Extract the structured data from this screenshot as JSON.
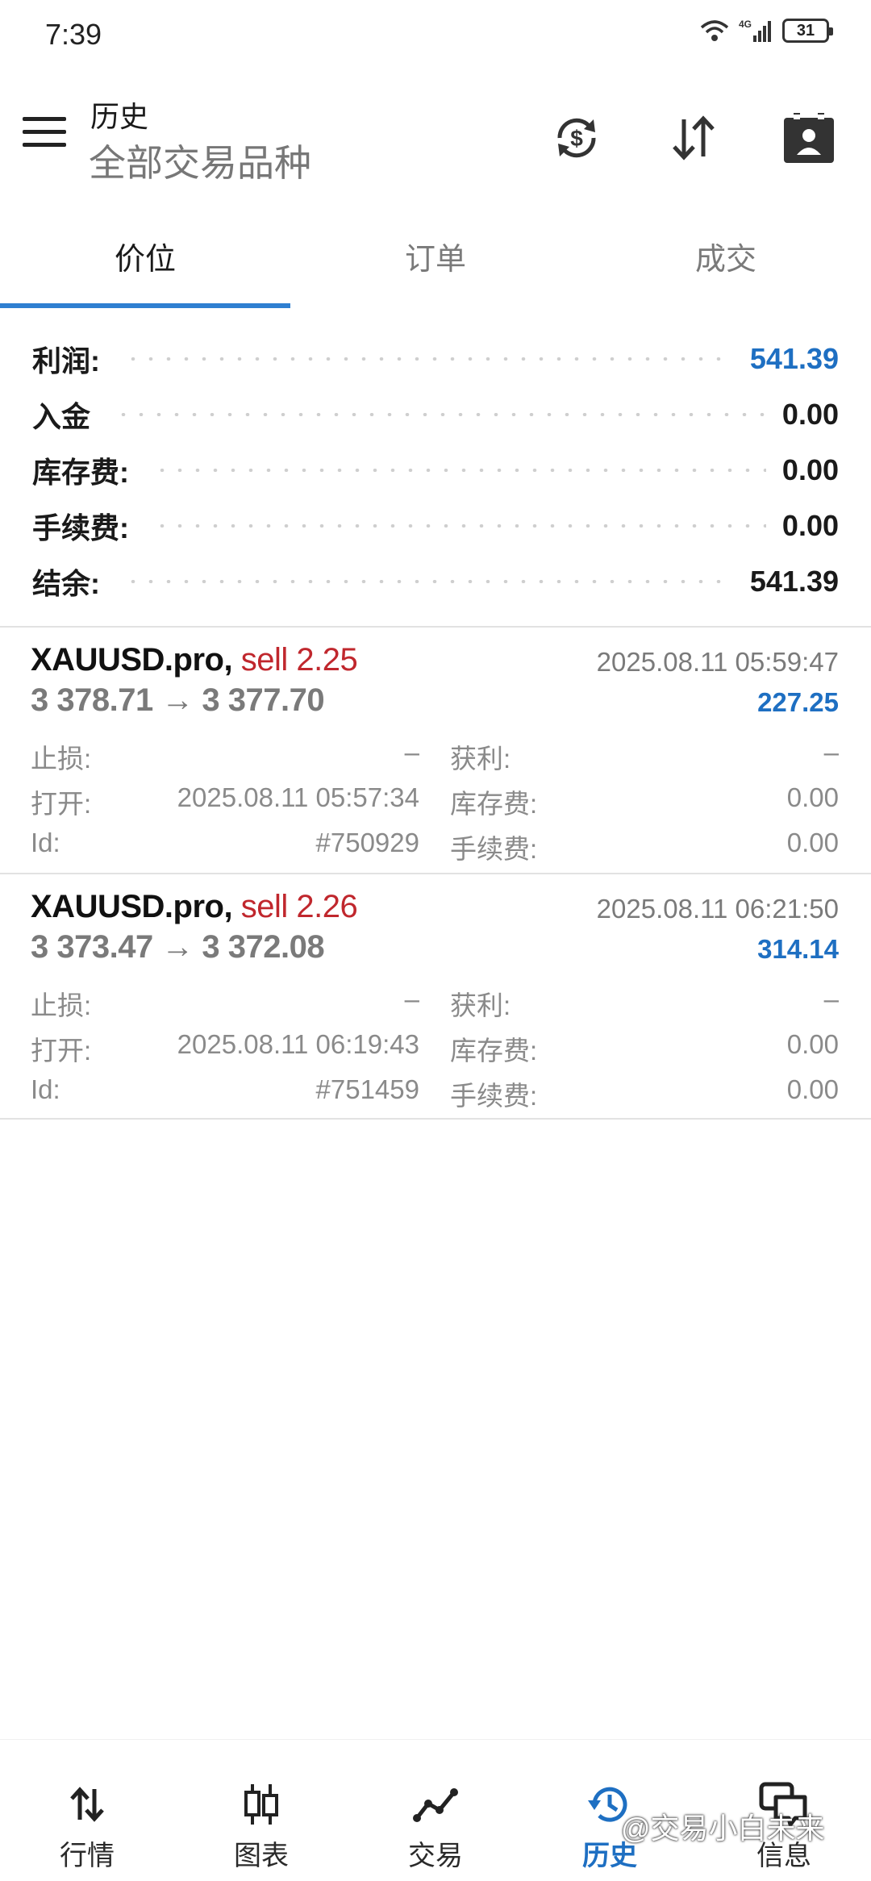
{
  "status_bar": {
    "time": "7:39",
    "network": "4G",
    "wifi_label": "6",
    "battery": "31"
  },
  "header": {
    "title": "历史",
    "subtitle": "全部交易品种",
    "icons": [
      "currency-exchange-icon",
      "sort-icon",
      "calendar-person-icon"
    ]
  },
  "tabs": [
    {
      "label": "价位",
      "active": true
    },
    {
      "label": "订单",
      "active": false
    },
    {
      "label": "成交",
      "active": false
    }
  ],
  "summary": [
    {
      "label": "利润:",
      "value": "541.39",
      "color": "#1e6fc2"
    },
    {
      "label": "入金",
      "value": "0.00"
    },
    {
      "label": "库存费:",
      "value": "0.00"
    },
    {
      "label": "手续费:",
      "value": "0.00"
    },
    {
      "label": "结余:",
      "value": "541.39"
    }
  ],
  "deals": [
    {
      "symbol": "XAUUSD.pro,",
      "side": "sell 2.25",
      "close_time": "2025.08.11 05:59:47",
      "prices": "3 378.71 → 3 377.70",
      "profit": "227.25",
      "sl_label": "止损:",
      "sl_value": "–",
      "tp_label": "获利:",
      "tp_value": "–",
      "open_label": "打开:",
      "open_value": "2025.08.11 05:57:34",
      "swap_label": "库存费:",
      "swap_value": "0.00",
      "id_label": "Id:",
      "id_value": "#750929",
      "fee_label": "手续费:",
      "fee_value": "0.00"
    },
    {
      "symbol": "XAUUSD.pro,",
      "side": "sell 2.26",
      "close_time": "2025.08.11 06:21:50",
      "prices": "3 373.47 → 3 372.08",
      "profit": "314.14",
      "sl_label": "止损:",
      "sl_value": "–",
      "tp_label": "获利:",
      "tp_value": "–",
      "open_label": "打开:",
      "open_value": "2025.08.11 06:19:43",
      "swap_label": "库存费:",
      "swap_value": "0.00",
      "id_label": "Id:",
      "id_value": "#751459",
      "fee_label": "手续费:",
      "fee_value": "0.00"
    }
  ],
  "bottom_nav": [
    {
      "label": "行情",
      "icon": "quotes-arrows-icon",
      "active": false
    },
    {
      "label": "图表",
      "icon": "candlestick-icon",
      "active": false
    },
    {
      "label": "交易",
      "icon": "trade-line-icon",
      "active": false
    },
    {
      "label": "历史",
      "icon": "history-clock-icon",
      "active": true
    },
    {
      "label": "信息",
      "icon": "chat-bubbles-icon",
      "active": false
    }
  ],
  "watermark": "@交易小白未来",
  "colors": {
    "accent": "#2f7fd1",
    "profit_blue": "#1e6fc2",
    "sell_red": "#c0272d",
    "muted": "#7a7a7a"
  }
}
